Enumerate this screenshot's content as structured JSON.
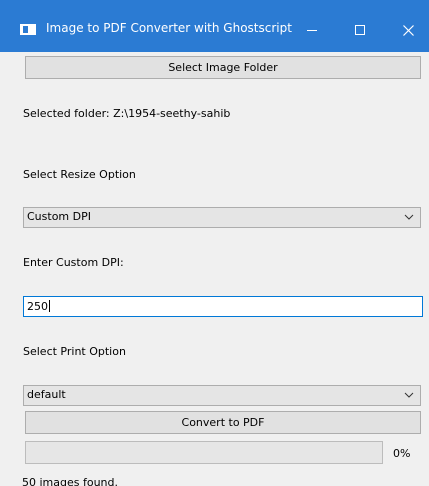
{
  "window": {
    "title": "Image to PDF Converter with Ghostscript",
    "icon": "app-window-icon"
  },
  "folder": {
    "select_button_label": "Select Image Folder",
    "selected_text": "Selected folder: Z:\\1954-seethy-sahib"
  },
  "resize": {
    "label": "Select Resize Option",
    "selected_value": "Custom DPI"
  },
  "dpi": {
    "label": "Enter Custom DPI:",
    "value": "250"
  },
  "print": {
    "label": "Select Print Option",
    "selected_value": "default"
  },
  "convert": {
    "button_label": "Convert to PDF"
  },
  "progress": {
    "fraction": 0,
    "percent_text": "0%"
  },
  "status": {
    "text": "50 images found."
  },
  "colors": {
    "titlebar": "#2b7bd3",
    "input_focus_border": "#0078d7",
    "background": "#f0f0f0"
  }
}
